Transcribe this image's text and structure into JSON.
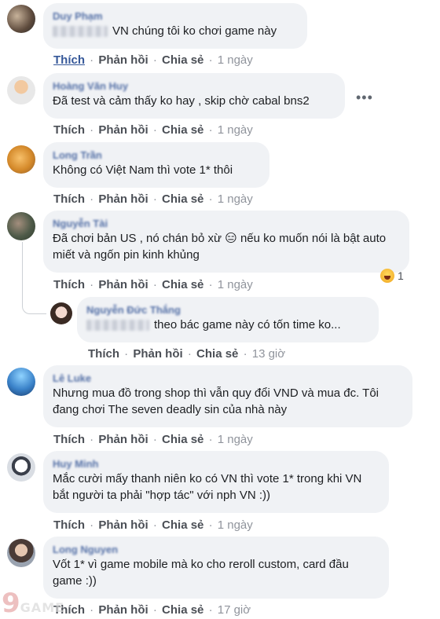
{
  "comments": [
    {
      "name": "Duy Phạm",
      "text": "VN chúng tôi ko chơi game này",
      "actions": {
        "like": "Thích",
        "reply": "Phản hồi",
        "share": "Chia sẻ",
        "sep": "·",
        "time": "1 ngày"
      }
    },
    {
      "name": "Hoàng Văn Huy",
      "text": "Đã test và cảm thấy ko hay , skip chờ cabal bns2",
      "more": "•••",
      "actions": {
        "like": "Thích",
        "reply": "Phản hồi",
        "share": "Chia sẻ",
        "sep": "·",
        "time": "1 ngày"
      }
    },
    {
      "name": "Long Trần",
      "text": "Không có Việt Nam thì vote 1* thôi",
      "actions": {
        "like": "Thích",
        "reply": "Phản hồi",
        "share": "Chia sẻ",
        "sep": "·",
        "time": "1 ngày"
      }
    },
    {
      "name": "Nguyễn Tài",
      "text": "Đã chơi bản US , nó chán bỏ xừ 😑 nếu ko muốn nói là bật auto miết và ngốn pin kinh khủng",
      "reaction_count": "1",
      "actions": {
        "like": "Thích",
        "reply": "Phản hồi",
        "share": "Chia sẻ",
        "sep": "·",
        "time": "1 ngày"
      }
    },
    {
      "name": "Nguyễn Đức Thắng",
      "text": "theo bác game này có tốn time ko...",
      "actions": {
        "like": "Thích",
        "reply": "Phản hồi",
        "share": "Chia sẻ",
        "sep": "·",
        "time": "13 giờ"
      }
    },
    {
      "name": "Lê Luke",
      "text": "Nhưng mua đồ trong shop thì vẫn quy đổi VND và mua đc. Tôi đang chơi The seven deadly sin của nhà này",
      "actions": {
        "like": "Thích",
        "reply": "Phản hồi",
        "share": "Chia sẻ",
        "sep": "·",
        "time": "1 ngày"
      }
    },
    {
      "name": "Huy Minh",
      "text": "Mắc cười mấy thanh niên ko có VN thì vote 1* trong khi VN bắt người ta phải \"hợp tác\" với nph VN :))",
      "actions": {
        "like": "Thích",
        "reply": "Phản hồi",
        "share": "Chia sẻ",
        "sep": "·",
        "time": "1 ngày"
      }
    },
    {
      "name": "Long Nguyen",
      "text": "Vốt 1* vì game mobile mà ko cho reroll custom, card đầu game :))",
      "actions": {
        "like": "Thích",
        "reply": "Phản hồi",
        "share": "Chia sẻ",
        "sep": "·",
        "time": "17 giờ"
      }
    }
  ],
  "watermark": {
    "logo": "9",
    "text": "GAME"
  },
  "colors": {
    "bubble": "#f0f2f5",
    "link": "#365899",
    "meta": "#90949c",
    "action": "#4b4f56"
  }
}
